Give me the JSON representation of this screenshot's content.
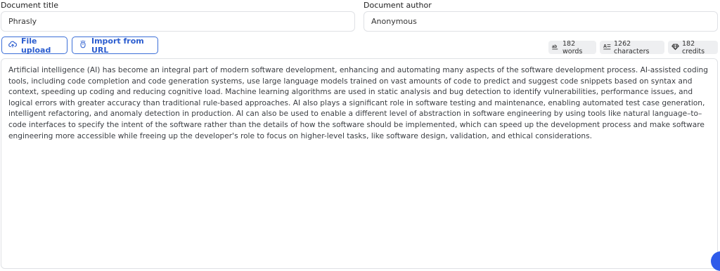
{
  "title_field": {
    "label": "Document title",
    "value": "Phrasly"
  },
  "author_field": {
    "label": "Document author",
    "value": "Anonymous"
  },
  "actions": {
    "file_upload_label": "File upload",
    "import_url_label": "Import from URL"
  },
  "stats": {
    "words": "182 words",
    "characters": "1262 characters",
    "credits": "182 credits"
  },
  "editor": {
    "text": "Artificial intelligence (AI) has become an integral part of modern software development, enhancing and automating many aspects of the software development process. AI-assisted coding tools, including code completion and code generation systems, use large language models trained on vast amounts of code to predict and suggest code snippets based on syntax and context, speeding up coding and reducing cognitive load. Machine learning algorithms are used in static analysis and bug detection to identify vulnerabilities, performance issues, and logical errors with greater accuracy than traditional rule-based approaches. AI also plays a significant role in software testing and maintenance, enabling automated test case generation, intelligent refactoring, and anomaly detection in production. AI can also be used to enable a different level of abstraction in software engineering by using tools like natural language–to–code interfaces to specify the intent of the software rather than the details of how the software should be implemented, which can speed up the development process and make software engineering more accessible while freeing up the developer's role to focus on higher-level tasks, like software design, validation, and ethical considerations."
  },
  "icons": {
    "file_upload": "cloud-upload-icon",
    "import_url": "mouse-click-icon",
    "words": "ab-words-icon",
    "characters": "text-format-icon",
    "credits": "diamond-icon"
  },
  "colors": {
    "accent": "#2a5ccf",
    "chip_bg": "#eeeff1",
    "border": "#dfe1e5",
    "fab": "#2f5bea"
  }
}
